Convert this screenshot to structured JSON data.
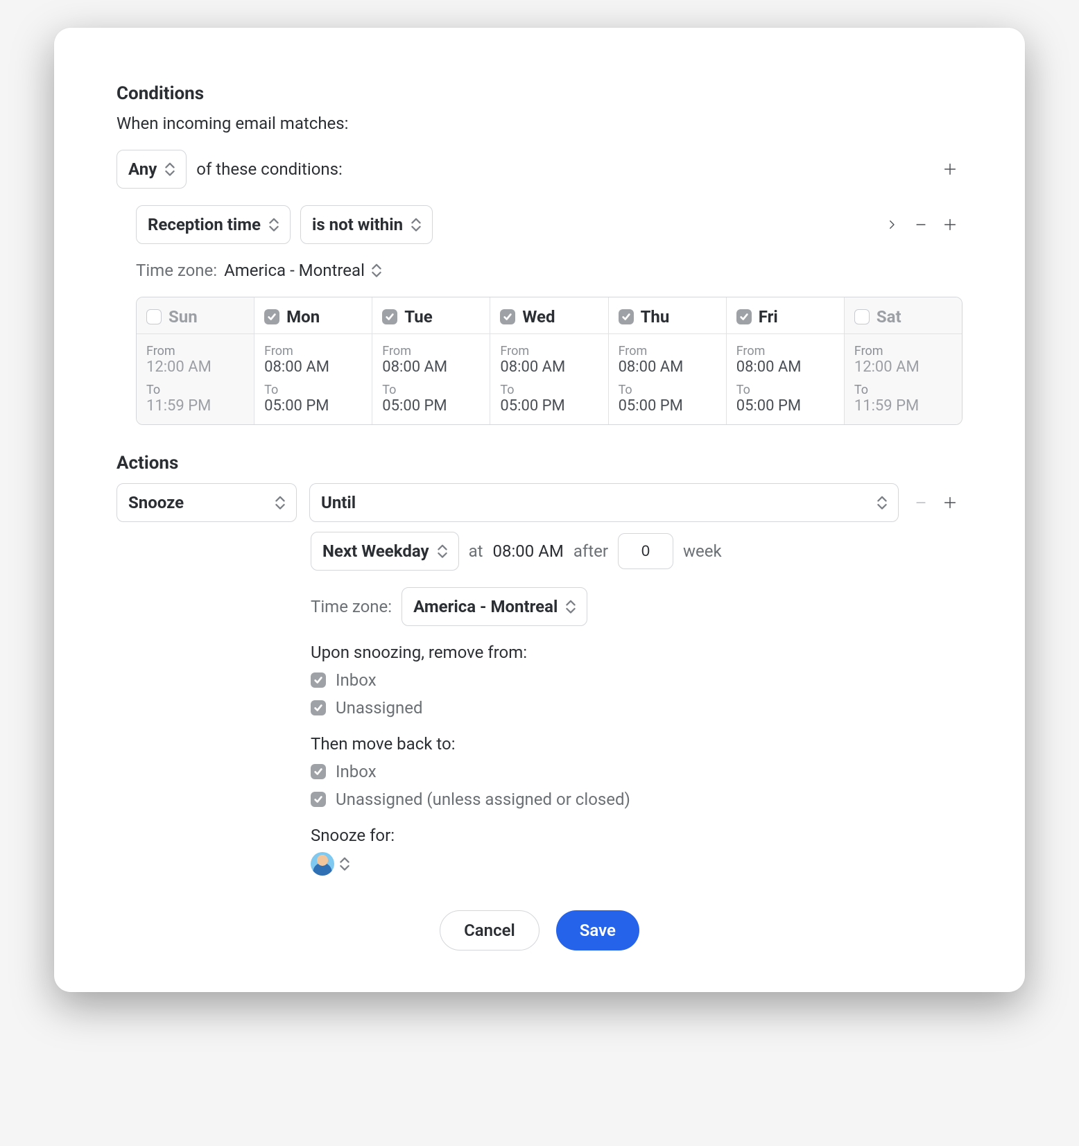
{
  "conditions": {
    "title": "Conditions",
    "intro": "When incoming email matches:",
    "match_mode": "Any",
    "match_suffix": "of these conditions:",
    "field_select": "Reception time",
    "operator_select": "is not within",
    "timezone_label": "Time zone:",
    "timezone_value": "America - Montreal",
    "days": [
      {
        "name": "Sun",
        "checked": false,
        "from": "12:00 AM",
        "to": "11:59 PM"
      },
      {
        "name": "Mon",
        "checked": true,
        "from": "08:00 AM",
        "to": "05:00 PM"
      },
      {
        "name": "Tue",
        "checked": true,
        "from": "08:00 AM",
        "to": "05:00 PM"
      },
      {
        "name": "Wed",
        "checked": true,
        "from": "08:00 AM",
        "to": "05:00 PM"
      },
      {
        "name": "Thu",
        "checked": true,
        "from": "08:00 AM",
        "to": "05:00 PM"
      },
      {
        "name": "Fri",
        "checked": true,
        "from": "08:00 AM",
        "to": "05:00 PM"
      },
      {
        "name": "Sat",
        "checked": false,
        "from": "12:00 AM",
        "to": "11:59 PM"
      }
    ],
    "from_label": "From",
    "to_label": "To"
  },
  "actions": {
    "title": "Actions",
    "action_select": "Snooze",
    "mode_select": "Until",
    "weekday_select": "Next Weekday",
    "at_label": "at",
    "at_time": "08:00 AM",
    "after_label": "after",
    "weeks_value": "0",
    "weeks_unit": "week",
    "timezone_label": "Time zone:",
    "timezone_value": "America - Montreal",
    "remove_from_label": "Upon snoozing, remove from:",
    "remove_from": [
      {
        "label": "Inbox",
        "checked": true
      },
      {
        "label": "Unassigned",
        "checked": true
      }
    ],
    "move_back_label": "Then move back to:",
    "move_back": [
      {
        "label": "Inbox",
        "checked": true
      },
      {
        "label": "Unassigned (unless assigned or closed)",
        "checked": true
      }
    ],
    "snooze_for_label": "Snooze for:"
  },
  "buttons": {
    "cancel": "Cancel",
    "save": "Save"
  }
}
